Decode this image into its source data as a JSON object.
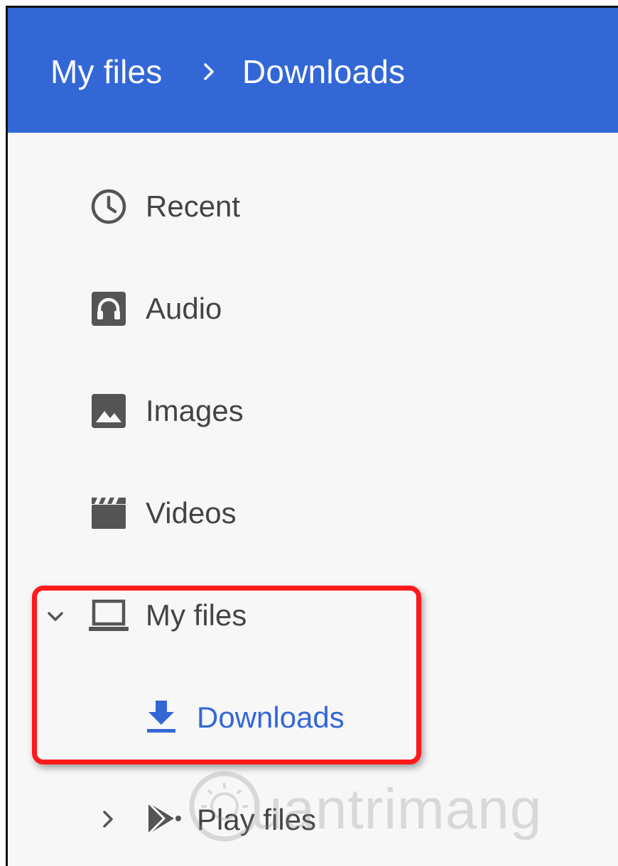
{
  "breadcrumb": {
    "root": "My files",
    "current": "Downloads"
  },
  "nav": {
    "recent": "Recent",
    "audio": "Audio",
    "images": "Images",
    "videos": "Videos",
    "my_files": "My files",
    "downloads": "Downloads",
    "play_files": "Play files"
  },
  "icons": {
    "recent": "clock-icon",
    "audio": "headphones-icon",
    "images": "image-icon",
    "videos": "clapperboard-icon",
    "my_files": "laptop-icon",
    "downloads": "download-icon",
    "play_files": "google-play-icon"
  },
  "watermark": "uantrimang",
  "colors": {
    "header": "#3367d6",
    "selected": "#3367d6",
    "highlight": "#ff1a1a",
    "text": "#444444"
  }
}
